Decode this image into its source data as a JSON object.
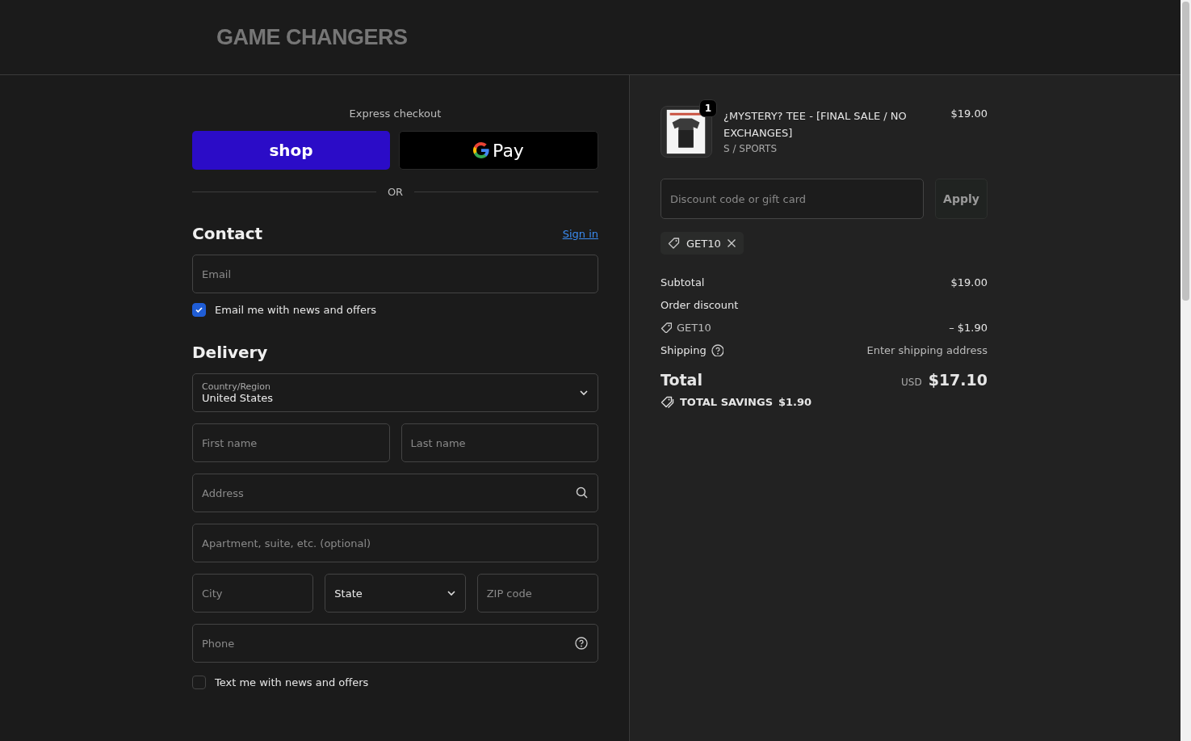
{
  "header": {
    "logo": "GAME CHANGERS"
  },
  "express": {
    "title": "Express checkout",
    "buttons": [
      {
        "kind": "shop",
        "label": "shop"
      },
      {
        "kind": "gpay",
        "label": "Pay"
      }
    ],
    "divider": "OR"
  },
  "contact": {
    "title": "Contact",
    "link": "Sign in",
    "fields": [
      {
        "kind": "text",
        "placeholder": "Email"
      }
    ],
    "checkbox": {
      "label": "Email me with news and offers",
      "checked": true
    }
  },
  "delivery": {
    "title": "Delivery",
    "rows": [
      [
        {
          "kind": "select",
          "label": "Country/Region",
          "value": "United States"
        }
      ],
      [
        {
          "kind": "text",
          "placeholder": "First name"
        },
        {
          "kind": "text",
          "placeholder": "Last name"
        }
      ],
      [
        {
          "kind": "search",
          "placeholder": "Address"
        }
      ],
      [
        {
          "kind": "text",
          "placeholder": "Apartment, suite, etc. (optional)"
        }
      ],
      [
        {
          "kind": "text",
          "placeholder": "City"
        },
        {
          "kind": "select",
          "value": "State"
        },
        {
          "kind": "text",
          "placeholder": "ZIP code"
        }
      ],
      [
        {
          "kind": "help",
          "placeholder": "Phone"
        }
      ]
    ],
    "checkbox": {
      "label": "Text me with news and offers",
      "checked": false
    }
  },
  "summary": {
    "items": [
      {
        "kind": "picture",
        "quantity": "1",
        "title": "¿MYSTERY? TEE - [FINAL SALE / NO EXCHANGES]",
        "variant": "S / SPORTS",
        "price": "$19.00"
      }
    ],
    "discount": {
      "placeholder": "Discount code or gift card",
      "button": "Apply",
      "tags": [
        "GET10"
      ]
    },
    "lines": [
      {
        "kind": "plain",
        "label": "Subtotal",
        "value": "$19.00"
      },
      {
        "kind": "heading",
        "label": "Order discount"
      },
      {
        "kind": "code",
        "label": "GET10",
        "value": "– $1.90"
      },
      {
        "kind": "help",
        "label": "Shipping",
        "value": "Enter shipping address"
      }
    ],
    "total": {
      "label": "Total",
      "currency": "USD",
      "value": "$17.10"
    },
    "savings": {
      "label": "TOTAL SAVINGS",
      "value": "$1.90"
    }
  }
}
